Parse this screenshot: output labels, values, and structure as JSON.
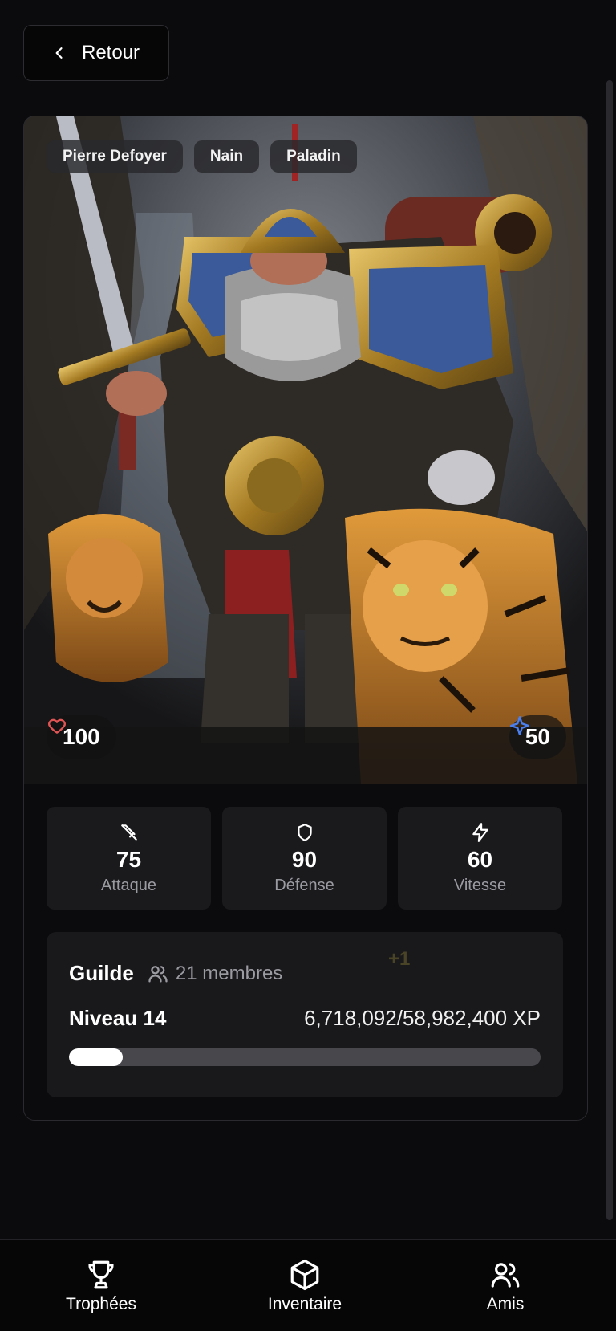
{
  "nav": {
    "back_label": "Retour"
  },
  "character": {
    "tags": [
      "Pierre Defoyer",
      "Nain",
      "Paladin"
    ],
    "health": "100",
    "mana": "50"
  },
  "stats": [
    {
      "icon": "sword-icon",
      "value": "75",
      "label": "Attaque"
    },
    {
      "icon": "shield-icon",
      "value": "90",
      "label": "Défense"
    },
    {
      "icon": "lightning-icon",
      "value": "60",
      "label": "Vitesse"
    }
  ],
  "guild": {
    "title": "Guilde",
    "members": "21 membres",
    "plus_indicator": "+1",
    "level_label": "Niveau 14",
    "xp_text": "6,718,092/58,982,400 XP",
    "xp_fraction": 0.114
  },
  "bottom_nav": {
    "trophies": "Trophées",
    "inventory": "Inventaire",
    "friends": "Amis"
  },
  "colors": {
    "heart": "#e05454",
    "mana": "#4a7ff0",
    "background": "#0b0b0d"
  }
}
